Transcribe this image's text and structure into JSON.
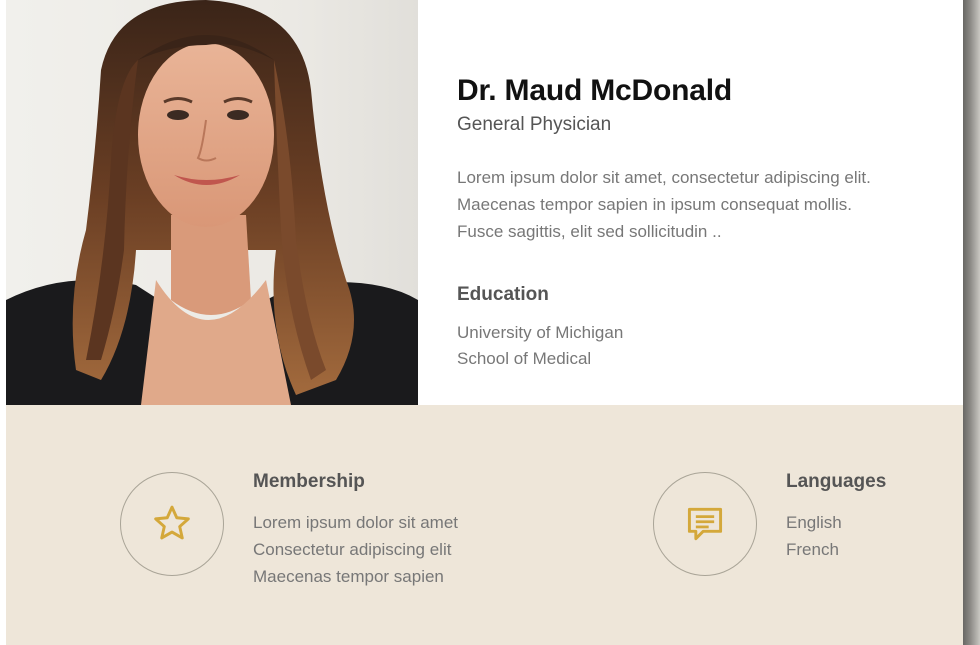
{
  "profile": {
    "name": "Dr. Maud McDonald",
    "role": "General Physician",
    "bio": "Lorem ipsum dolor sit amet, consectetur adipiscing elit. Maecenas tempor sapien in ipsum consequat mollis. Fusce sagittis, elit sed sollicitudin ..",
    "photo_alt": "portrait-photo"
  },
  "education": {
    "title": "Education",
    "lines": [
      "University of Michigan",
      "School of Medical"
    ]
  },
  "membership": {
    "title": "Membership",
    "icon": "star-icon",
    "lines": [
      "Lorem ipsum dolor sit amet",
      "Consectetur adipiscing elit",
      "Maecenas tempor sapien"
    ]
  },
  "languages": {
    "title": "Languages",
    "icon": "chat-icon",
    "lines": [
      "English",
      "French"
    ]
  },
  "colors": {
    "accent": "#d4a83a",
    "section_bg": "#eee6d9",
    "circle_border": "#a9a497"
  }
}
